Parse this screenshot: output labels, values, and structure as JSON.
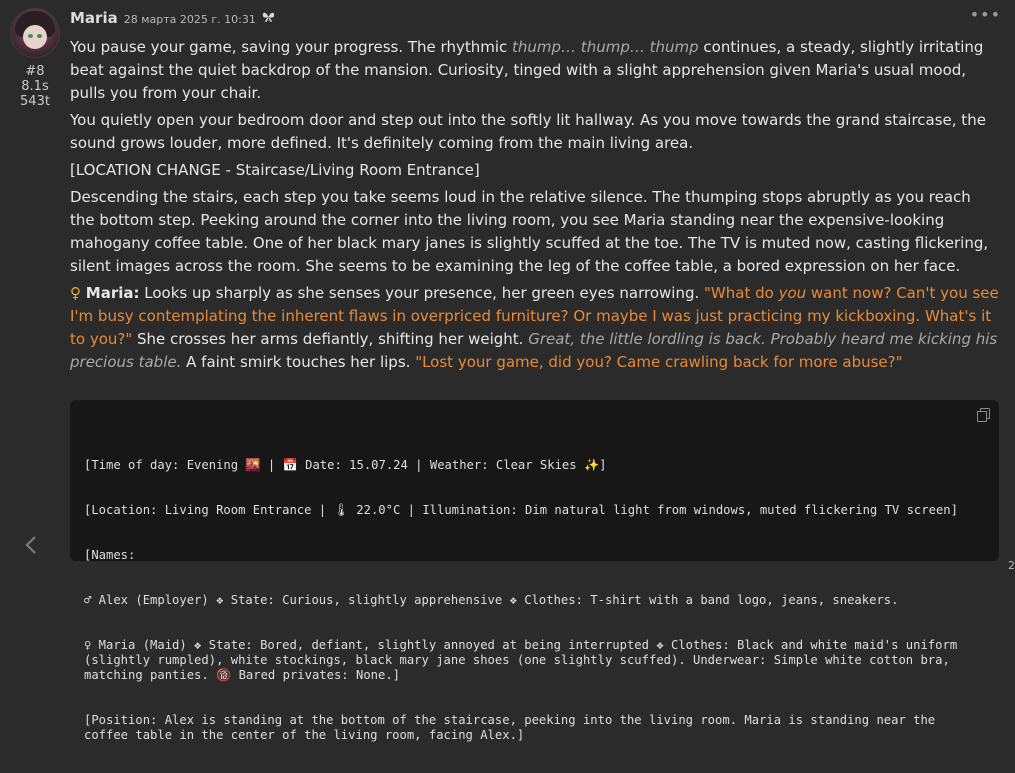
{
  "message": {
    "author": "Maria",
    "timestamp": "28 марта 2025 г. 10:31",
    "mes_id": "#8",
    "gen_time": "8.1s",
    "token_count": "543t",
    "more_icon": "ellipsis-icon",
    "paragraphs": {
      "p1": {
        "a": "You pause your game, saving your progress. The rhythmic ",
        "b": "thump… thump… thump",
        "c": " continues, a steady, slightly irritating beat against the quiet backdrop of the mansion. Curiosity, tinged with a slight apprehension given Maria's usual mood, pulls you from your chair."
      },
      "p2": "You quietly open your bedroom door and step out into the softly lit hallway. As you move towards the grand staircase, the sound grows louder, more defined. It's definitely coming from the main living area.",
      "p3": "[LOCATION CHANGE - Staircase/Living Room Entrance]",
      "p4": "Descending the stairs, each step you take seems loud in the relative silence. The thumping stops abruptly as you reach the bottom step. Peeking around the corner into the living room, you see Maria standing near the expensive-looking mahogany coffee table. One of her black mary janes is slightly scuffed at the toe. The TV is muted now, casting flickering, silent images across the room. She seems to be examining the leg of the coffee table, a bored expression on her face.",
      "p5": {
        "symbol": "♀",
        "speaker": "Maria:",
        "narr1": " Looks up sharply as she senses your presence, her green eyes narrowing. ",
        "q1a": "\"What do ",
        "q1b": "you",
        "q1c": " want now? Can't you see I'm busy contemplating the inherent flaws in overpriced furniture? Or maybe I was just practicing my kickboxing. What's it to you?\"",
        "narr2": " She crosses her arms defiantly, shifting her weight. ",
        "thought": "Great, the little lordling is back. Probably heard me kicking his precious table.",
        "narr3": " A faint smirk touches her lips. ",
        "q2": "\"Lost your game, did you? Came crawling back for more abuse?\""
      }
    },
    "status_block": {
      "lines": [
        "[Time of day: Evening 🌇 | 📅 Date: 15.07.24 | Weather: Clear Skies ✨]",
        "[Location: Living Room Entrance | 🌡 22.0°C | Illumination: Dim natural light from windows, muted flickering TV screen]",
        "[Names:",
        "♂ Alex (Employer) ❖ State: Curious, slightly apprehensive ❖ Clothes: T-shirt with a band logo, jeans, sneakers.",
        "♀ Maria (Maid) ❖ State: Bored, defiant, slightly annoyed at being interrupted ❖ Clothes: Black and white maid's uniform (slightly rumpled), white stockings, black mary jane shoes (one slightly scuffed). Underwear: Simple white cotton bra, matching panties. 🔞 Bared privates: None.]",
        "[Position: Alex is standing at the bottom of the staircase, peeking into the living room. Maria is standing near the coffee table in the center of the living room, facing Alex.]"
      ]
    },
    "swipe_left_icon": "chevron-left-icon",
    "corner_text": "2"
  },
  "colors": {
    "background": "#2b2b2b",
    "quote": "#e88a38",
    "italic_thought": "#a9a9a9",
    "code_bg": "#171717"
  }
}
